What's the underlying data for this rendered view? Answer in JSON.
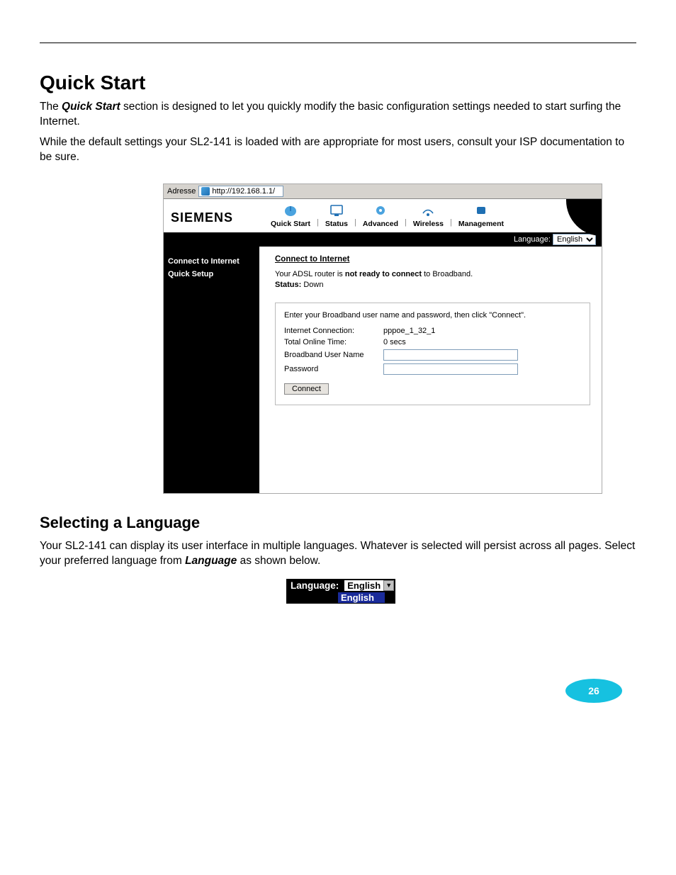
{
  "header": {},
  "section": {
    "title": "Quick Start",
    "intro1_prefix": "The ",
    "intro1_bold": "Quick Start",
    "intro1_suffix": " section is designed to let you quickly modify the basic configuration settings needed to start surfing the Internet.",
    "intro2": "While the default settings your SL2-141 is loaded with are appropriate for most users, consult your ISP documentation to be sure."
  },
  "router": {
    "address_label": "Adresse",
    "url": "http://192.168.1.1/",
    "brand": "SIEMENS",
    "nav": {
      "quick_start": "Quick Start",
      "status": "Status",
      "advanced": "Advanced",
      "wireless": "Wireless",
      "management": "Management"
    },
    "language_label": "Language:",
    "language_value": "English",
    "sidebar": {
      "item1": "Connect to Internet",
      "item2": "Quick Setup"
    },
    "pane": {
      "title": "Connect to Internet",
      "line1_pre": "Your ADSL router is ",
      "line1_bold": "not ready to connect",
      "line1_post": " to Broadband.",
      "status_label": "Status:",
      "status_value": "Down",
      "form_prompt": "Enter your Broadband user name and password, then click \"Connect\".",
      "internet_conn_label": "Internet Connection:",
      "internet_conn_value": "pppoe_1_32_1",
      "total_online_label": "Total Online Time:",
      "total_online_value": "0 secs",
      "username_label": "Broadband User Name",
      "password_label": "Password",
      "connect_btn": "Connect"
    }
  },
  "selecting_lang": {
    "title": "Selecting a Language",
    "para_prefix": "Your SL2-141 can display its user interface in multiple languages. Whatever is selected will persist across all pages. Select your preferred language from ",
    "para_bold": "Language",
    "para_suffix": " as shown below.",
    "zoom_label": "Language:",
    "zoom_value": "English",
    "zoom_open_option": "English"
  },
  "footer": {
    "page_number": "26"
  }
}
